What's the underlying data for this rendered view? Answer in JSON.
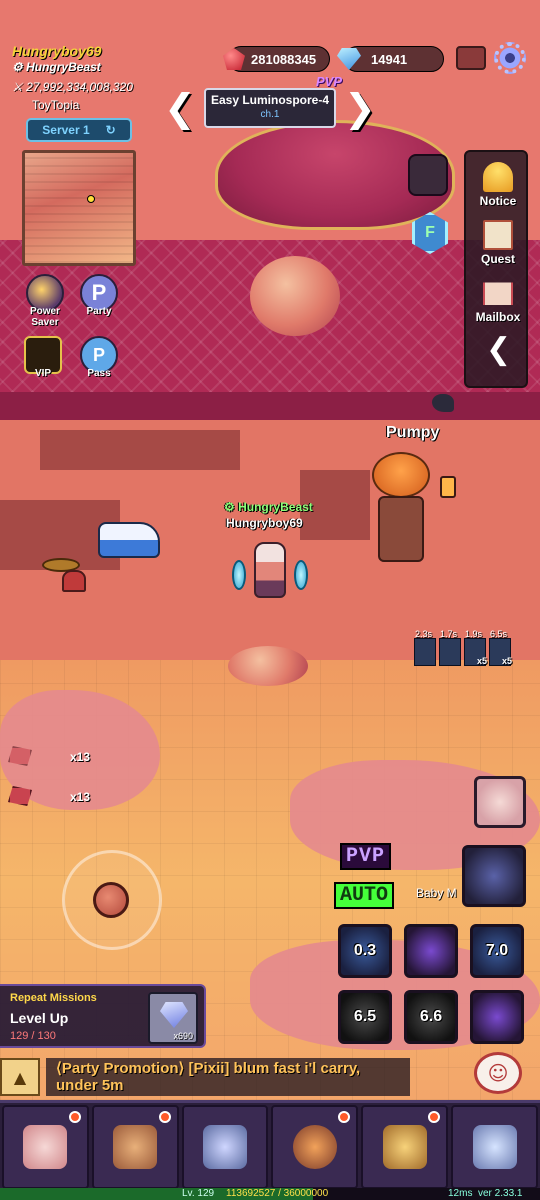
{
  "player": {
    "name": "Hungryboy69",
    "guild": "HungryBeast",
    "power": "27,992,334,008,320",
    "map": "ToyTopia",
    "server": "Server 1"
  },
  "currency": {
    "red_gems": "281088345",
    "diamonds": "14941"
  },
  "stage": {
    "title": "Easy Luminospore-4",
    "chapter": "ch.1",
    "mode_tag": "PVP"
  },
  "side_menu": [
    {
      "label": "Notice",
      "icon": "bell-icon"
    },
    {
      "label": "Quest",
      "icon": "clipboard-icon"
    },
    {
      "label": "Mailbox",
      "icon": "envelope-icon"
    }
  ],
  "left_buttons": {
    "power_saver": "Power Saver",
    "party": "Party",
    "vip": "VIP",
    "pass": "Pass"
  },
  "world": {
    "npc_name": "Pumpy",
    "hero_guild": "HungryBeast",
    "hero_name": "Hungryboy69",
    "drops": [
      {
        "count": "x13"
      },
      {
        "count": "x13"
      }
    ],
    "buffs": [
      {
        "time": "2.3s",
        "stack": ""
      },
      {
        "time": "1.7s",
        "stack": ""
      },
      {
        "time": "1.9s",
        "stack": "x5"
      },
      {
        "time": "6.5s",
        "stack": "x5"
      }
    ]
  },
  "controls": {
    "pvp_label": "PVP",
    "auto_label": "AUTO",
    "pet_label": "Baby M"
  },
  "skills": [
    {
      "cooldown": "0.3"
    },
    {
      "cooldown": ""
    },
    {
      "cooldown": "7.0"
    },
    {
      "cooldown": "6.5"
    },
    {
      "cooldown": "6.6"
    },
    {
      "cooldown": ""
    }
  ],
  "mission": {
    "header": "Repeat Missions",
    "title": "Level Up",
    "progress": "129 / 130",
    "reward_qty": "x690"
  },
  "chat": {
    "message": "⟨Party Promotion⟩ [Pixii] blum fast i'l carry, under 5m"
  },
  "bottom_nav": [
    {
      "name": "character",
      "badge": true
    },
    {
      "name": "inventory",
      "badge": true
    },
    {
      "name": "equipment",
      "badge": false
    },
    {
      "name": "skills",
      "badge": true
    },
    {
      "name": "codex",
      "badge": true
    },
    {
      "name": "shop",
      "badge": false
    }
  ],
  "status": {
    "level": "Lv. 129",
    "exp": "113692527 / 36000000",
    "exp_fill": 0.58,
    "ping": "12ms",
    "version": "ver 2.33.1"
  },
  "colors": {
    "name_gold": "#f5d23b",
    "guild_green": "#8dff7a",
    "auto_green": "#45ff3a",
    "pvp_purple": "#caa2ff"
  }
}
